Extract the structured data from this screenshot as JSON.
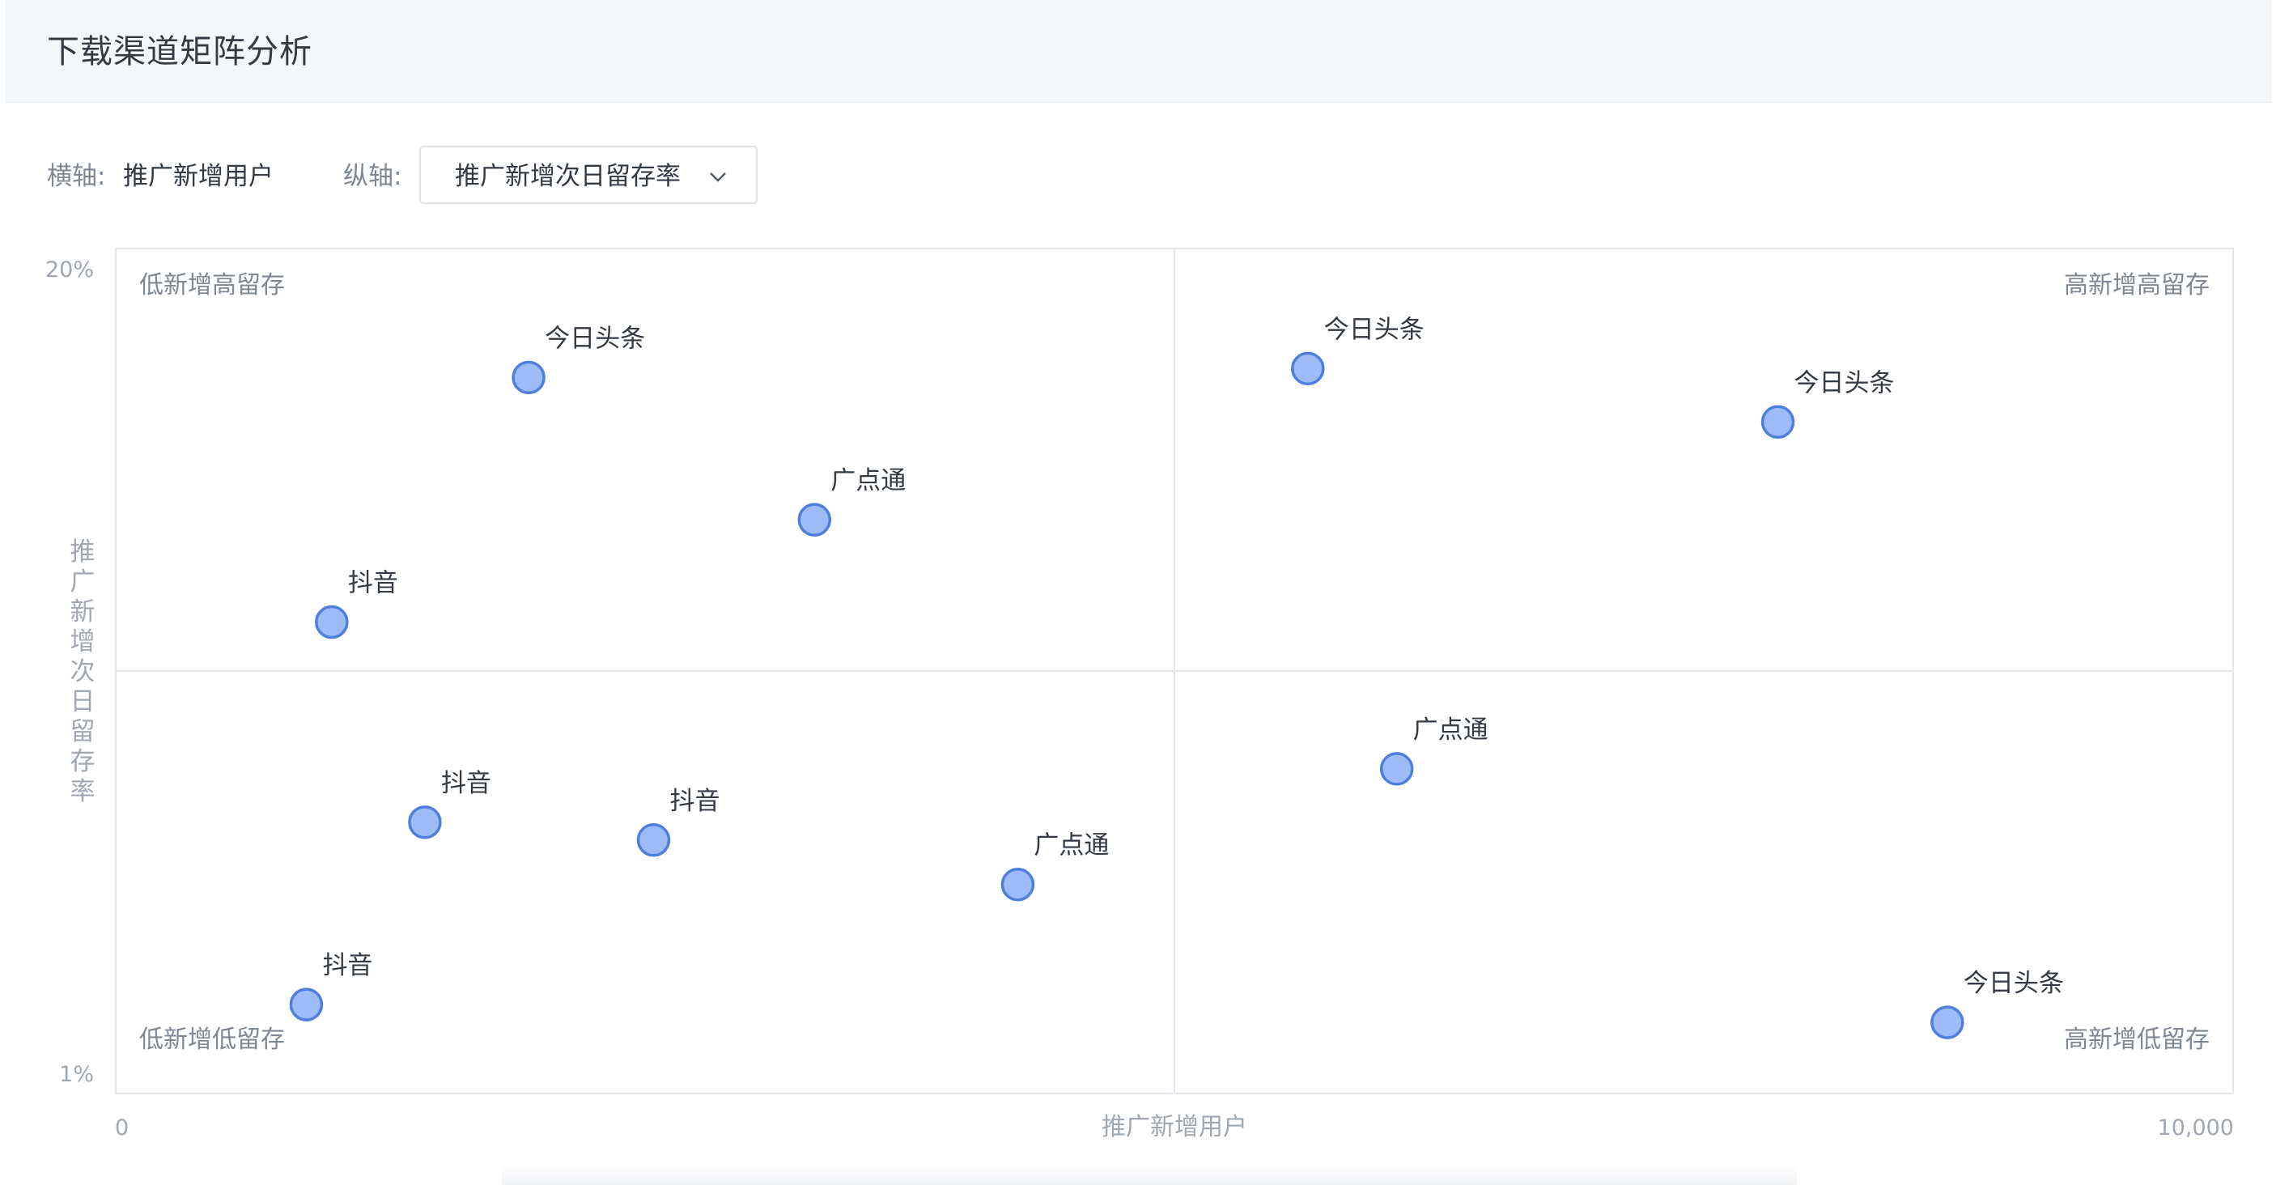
{
  "header": {
    "title": "下载渠道矩阵分析"
  },
  "controls": {
    "x_label": "横轴:",
    "x_value": "推广新增用户",
    "y_label": "纵轴:",
    "y_select_value": "推广新增次日留存率",
    "y_select_icon": "chevron-down-icon"
  },
  "colors": {
    "point_fill": "#9dbcf7",
    "point_stroke": "#4f7fdc",
    "grid": "#e3e6ea",
    "quadrant_text": "#7f8792",
    "axis_text": "#a0a7b1",
    "label_text": "#333a44"
  },
  "chart_data": {
    "type": "scatter",
    "title": "",
    "xlabel": "推广新增用户",
    "ylabel": "推广新增次日留存率",
    "xlim": [
      0,
      10000
    ],
    "ylim": [
      1,
      20
    ],
    "x_tick_labels": [
      "0",
      "10,000"
    ],
    "y_tick_labels": [
      "20%",
      "1%"
    ],
    "quadrants": {
      "top_left": "低新增高留存",
      "top_right": "高新增高留存",
      "bottom_left": "低新增低留存",
      "bottom_right": "高新增低留存"
    },
    "grid": "midlines",
    "points": [
      {
        "label": "今日头条",
        "x": 1950,
        "y": 17.1
      },
      {
        "label": "广点通",
        "x": 3300,
        "y": 13.9
      },
      {
        "label": "抖音",
        "x": 1020,
        "y": 11.6
      },
      {
        "label": "今日头条",
        "x": 5630,
        "y": 17.3
      },
      {
        "label": "今日头条",
        "x": 7850,
        "y": 16.1
      },
      {
        "label": "抖音",
        "x": 1460,
        "y": 7.1
      },
      {
        "label": "抖音",
        "x": 2540,
        "y": 6.7
      },
      {
        "label": "广点通",
        "x": 4260,
        "y": 5.7
      },
      {
        "label": "广点通",
        "x": 6050,
        "y": 8.3
      },
      {
        "label": "抖音",
        "x": 900,
        "y": 3.0
      },
      {
        "label": "今日头条",
        "x": 8650,
        "y": 2.6
      }
    ]
  }
}
